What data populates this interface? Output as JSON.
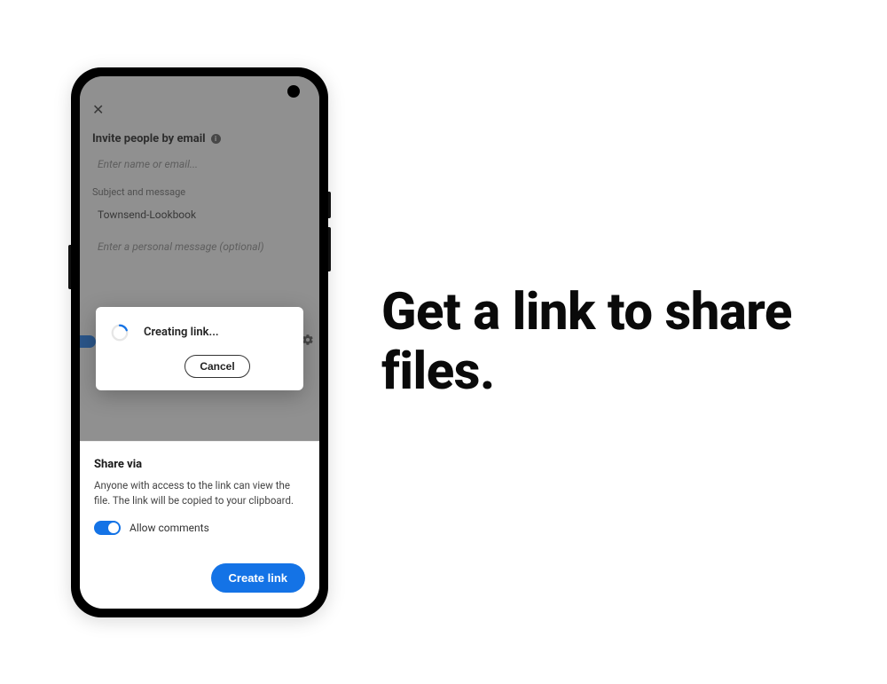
{
  "headline": "Get a link to share files.",
  "upper": {
    "invite_label": "Invite people by email",
    "name_placeholder": "Enter name or email...",
    "section_label": "Subject and message",
    "subject_value": "Townsend-Lookbook",
    "message_placeholder": "Enter a personal message (optional)"
  },
  "dialog": {
    "status_text": "Creating link...",
    "cancel_label": "Cancel"
  },
  "sheet": {
    "title": "Share via",
    "description": "Anyone with access to the link can view the file. The link will be copied to your clipboard.",
    "allow_comments_label": "Allow comments",
    "create_label": "Create link"
  }
}
